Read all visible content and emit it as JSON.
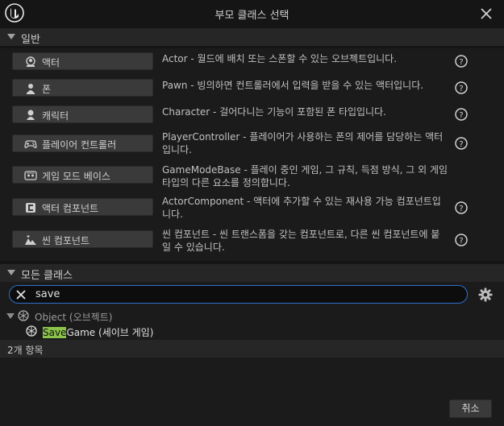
{
  "window": {
    "title": "부모 클래스 선택"
  },
  "common_section": {
    "label": "일반",
    "items": [
      {
        "name": "액터",
        "icon": "actor-icon",
        "description": "Actor - 월드에 배치 또는 스폰할 수 있는 오브젝트입니다."
      },
      {
        "name": "폰",
        "icon": "pawn-icon",
        "description": "Pawn - 빙의하면 컨트롤러에서 입력을 받을 수 있는 액터입니다."
      },
      {
        "name": "캐릭터",
        "icon": "character-icon",
        "description": "Character - 걸어다니는 기능이 포함된 폰 타입입니다."
      },
      {
        "name": "플레이어 컨트롤러",
        "icon": "gamepad-icon",
        "description": "PlayerController - 플레이어가 사용하는 폰의 제어를 담당하는 액터입니다."
      },
      {
        "name": "게임 모드 베이스",
        "icon": "game-mode-icon",
        "description": "GameModeBase - 플레이 중인 게임, 그 규칙, 득점 방식, 그 외 게임 타입의 다른 요소를 정의합니다."
      },
      {
        "name": "액터 컴포넌트",
        "icon": "actor-component-icon",
        "description": "ActorComponent - 액터에 추가할 수 있는 재사용 가능 컴포넌트입니다."
      },
      {
        "name": "씬 컴포넌트",
        "icon": "scene-component-icon",
        "description": "씬 컴포넌트 - 씬 트랜스폼을 갖는 컴포넌트로, 다른 씬 컴포넌트에 붙일 수 있습니다."
      }
    ]
  },
  "all_classes_section": {
    "label": "모든 클래스"
  },
  "search": {
    "value": "save",
    "placeholder": ""
  },
  "tree": {
    "root": {
      "label": "Object (오브젝트)"
    },
    "child": {
      "highlight": "Save",
      "rest": "Game (세이브 게임)"
    }
  },
  "status": {
    "count_text": "2개 항목"
  },
  "footer": {
    "cancel_label": "취소"
  },
  "colors": {
    "accent": "#2f6fd0",
    "highlight": "#8bc24a"
  }
}
